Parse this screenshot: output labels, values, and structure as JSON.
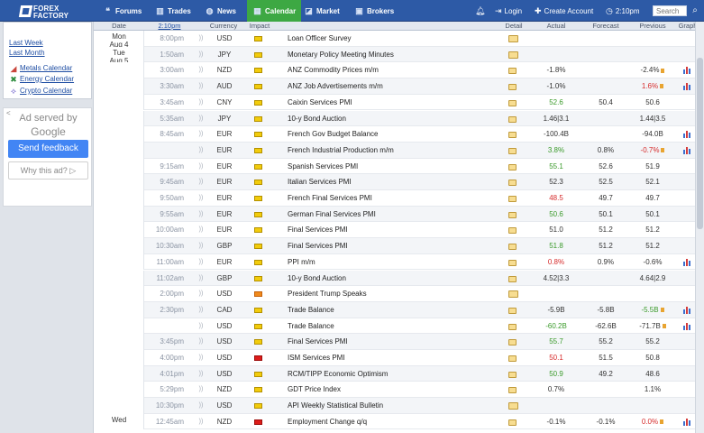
{
  "logo": {
    "line1": "FOREX",
    "line2": "FACTORY"
  },
  "nav": [
    {
      "label": "Forums",
      "icon": "forums-icon",
      "glyph": "❝",
      "active": false
    },
    {
      "label": "Trades",
      "icon": "trades-icon",
      "glyph": "▥",
      "active": false
    },
    {
      "label": "News",
      "icon": "news-icon",
      "glyph": "◍",
      "active": false
    },
    {
      "label": "Calendar",
      "icon": "calendar-icon",
      "glyph": "▦",
      "active": true
    },
    {
      "label": "Market",
      "icon": "market-icon",
      "glyph": "◪",
      "active": false
    },
    {
      "label": "Brokers",
      "icon": "brokers-icon",
      "glyph": "▣",
      "active": false
    }
  ],
  "header_right": {
    "login": "Login",
    "create_account": "Create Account",
    "clock": "2:10pm",
    "search_placeholder": "Search"
  },
  "sidebar": {
    "links": [
      "Last Week",
      "Last Month"
    ],
    "calendars": [
      {
        "label": "Metals Calendar",
        "icon": "metals-icon"
      },
      {
        "label": "Energy Calendar",
        "icon": "energy-icon"
      },
      {
        "label": "Crypto Calendar",
        "icon": "crypto-icon"
      }
    ]
  },
  "ad": {
    "close": "<",
    "served_by": "Ad served by",
    "google": "Google",
    "send_feedback": "Send feedback",
    "why": "Why this ad?"
  },
  "columns": {
    "date": "Date",
    "time": "2:10pm",
    "currency": "Currency",
    "impact": "Impact",
    "detail": "Detail",
    "actual": "Actual",
    "forecast": "Forecast",
    "previous": "Previous",
    "graph": "Graph"
  },
  "rows": [
    {
      "day": "Mon",
      "date": "Aug 4",
      "time": "8:00pm",
      "cur": "USD",
      "impact": "low",
      "event": "Loan Officer Survey",
      "actual": "",
      "forecast": "",
      "previous": "",
      "act_cls": "",
      "prev_cls": "",
      "rev": false,
      "graph": false
    },
    {
      "day": "Tue",
      "date": "Aug 5",
      "time": "1:50am",
      "cur": "JPY",
      "impact": "low",
      "event": "Monetary Policy Meeting Minutes",
      "actual": "",
      "forecast": "",
      "previous": "",
      "act_cls": "",
      "prev_cls": "",
      "rev": false,
      "graph": false
    },
    {
      "day": "",
      "date": "",
      "time": "3:00am",
      "cur": "NZD",
      "impact": "low",
      "event": "ANZ Commodity Prices m/m",
      "actual": "-1.8%",
      "forecast": "",
      "previous": "-2.4%",
      "act_cls": "",
      "prev_cls": "",
      "rev": true,
      "graph": true
    },
    {
      "day": "",
      "date": "",
      "time": "3:30am",
      "cur": "AUD",
      "impact": "low",
      "event": "ANZ Job Advertisements m/m",
      "actual": "-1.0%",
      "forecast": "",
      "previous": "1.6%",
      "act_cls": "",
      "prev_cls": "worse",
      "rev": true,
      "graph": true
    },
    {
      "day": "",
      "date": "",
      "time": "3:45am",
      "cur": "CNY",
      "impact": "low",
      "event": "Caixin Services PMI",
      "actual": "52.6",
      "forecast": "50.4",
      "previous": "50.6",
      "act_cls": "better",
      "prev_cls": "",
      "rev": false,
      "graph": false
    },
    {
      "day": "",
      "date": "",
      "time": "5:35am",
      "cur": "JPY",
      "impact": "low",
      "event": "10-y Bond Auction",
      "actual": "1.46|3.1",
      "forecast": "",
      "previous": "1.44|3.5",
      "act_cls": "",
      "prev_cls": "",
      "rev": false,
      "graph": false
    },
    {
      "day": "",
      "date": "",
      "time": "8:45am",
      "cur": "EUR",
      "impact": "low",
      "event": "French Gov Budget Balance",
      "actual": "-100.4B",
      "forecast": "",
      "previous": "-94.0B",
      "act_cls": "",
      "prev_cls": "",
      "rev": false,
      "graph": true
    },
    {
      "day": "",
      "date": "",
      "time": "",
      "cur": "EUR",
      "impact": "low",
      "event": "French Industrial Production m/m",
      "actual": "3.8%",
      "forecast": "0.8%",
      "previous": "-0.7%",
      "act_cls": "better",
      "prev_cls": "worse",
      "rev": true,
      "graph": true
    },
    {
      "day": "",
      "date": "",
      "time": "9:15am",
      "cur": "EUR",
      "impact": "low",
      "event": "Spanish Services PMI",
      "actual": "55.1",
      "forecast": "52.6",
      "previous": "51.9",
      "act_cls": "better",
      "prev_cls": "",
      "rev": false,
      "graph": false
    },
    {
      "day": "",
      "date": "",
      "time": "9:45am",
      "cur": "EUR",
      "impact": "low",
      "event": "Italian Services PMI",
      "actual": "52.3",
      "forecast": "52.5",
      "previous": "52.1",
      "act_cls": "",
      "prev_cls": "",
      "rev": false,
      "graph": false
    },
    {
      "day": "",
      "date": "",
      "time": "9:50am",
      "cur": "EUR",
      "impact": "low",
      "event": "French Final Services PMI",
      "actual": "48.5",
      "forecast": "49.7",
      "previous": "49.7",
      "act_cls": "worse",
      "prev_cls": "",
      "rev": false,
      "graph": false
    },
    {
      "day": "",
      "date": "",
      "time": "9:55am",
      "cur": "EUR",
      "impact": "low",
      "event": "German Final Services PMI",
      "actual": "50.6",
      "forecast": "50.1",
      "previous": "50.1",
      "act_cls": "better",
      "prev_cls": "",
      "rev": false,
      "graph": false
    },
    {
      "day": "",
      "date": "",
      "time": "10:00am",
      "cur": "EUR",
      "impact": "low",
      "event": "Final Services PMI",
      "actual": "51.0",
      "forecast": "51.2",
      "previous": "51.2",
      "act_cls": "",
      "prev_cls": "",
      "rev": false,
      "graph": false
    },
    {
      "day": "",
      "date": "",
      "time": "10:30am",
      "cur": "GBP",
      "impact": "low",
      "event": "Final Services PMI",
      "actual": "51.8",
      "forecast": "51.2",
      "previous": "51.2",
      "act_cls": "better",
      "prev_cls": "",
      "rev": false,
      "graph": false
    },
    {
      "day": "",
      "date": "",
      "time": "11:00am",
      "cur": "EUR",
      "impact": "low",
      "event": "PPI m/m",
      "actual": "0.8%",
      "forecast": "0.9%",
      "previous": "-0.6%",
      "act_cls": "worse",
      "prev_cls": "",
      "rev": false,
      "graph": true
    },
    {
      "day": "",
      "date": "",
      "time": "11:02am",
      "cur": "GBP",
      "impact": "low",
      "event": "10-y Bond Auction",
      "actual": "4.52|3.3",
      "forecast": "",
      "previous": "4.64|2.9",
      "act_cls": "",
      "prev_cls": "",
      "rev": false,
      "graph": false
    },
    {
      "day": "",
      "date": "",
      "time": "2:00pm",
      "cur": "USD",
      "impact": "med",
      "event": "President Trump Speaks",
      "actual": "",
      "forecast": "",
      "previous": "",
      "act_cls": "",
      "prev_cls": "",
      "rev": false,
      "graph": false
    },
    {
      "day": "",
      "date": "",
      "time": "2:30pm",
      "cur": "CAD",
      "impact": "low",
      "event": "Trade Balance",
      "actual": "-5.9B",
      "forecast": "-5.8B",
      "previous": "-5.5B",
      "act_cls": "",
      "prev_cls": "better",
      "rev": true,
      "graph": true
    },
    {
      "day": "",
      "date": "",
      "time": "",
      "cur": "USD",
      "impact": "low",
      "event": "Trade Balance",
      "actual": "-60.2B",
      "forecast": "-62.6B",
      "previous": "-71.7B",
      "act_cls": "better",
      "prev_cls": "",
      "rev": true,
      "graph": true
    },
    {
      "day": "",
      "date": "",
      "time": "3:45pm",
      "cur": "USD",
      "impact": "low",
      "event": "Final Services PMI",
      "actual": "55.7",
      "forecast": "55.2",
      "previous": "55.2",
      "act_cls": "better",
      "prev_cls": "",
      "rev": false,
      "graph": false
    },
    {
      "day": "",
      "date": "",
      "time": "4:00pm",
      "cur": "USD",
      "impact": "high",
      "event": "ISM Services PMI",
      "actual": "50.1",
      "forecast": "51.5",
      "previous": "50.8",
      "act_cls": "worse",
      "prev_cls": "",
      "rev": false,
      "graph": false
    },
    {
      "day": "",
      "date": "",
      "time": "4:01pm",
      "cur": "USD",
      "impact": "low",
      "event": "RCM/TIPP Economic Optimism",
      "actual": "50.9",
      "forecast": "49.2",
      "previous": "48.6",
      "act_cls": "better",
      "prev_cls": "",
      "rev": false,
      "graph": false
    },
    {
      "day": "",
      "date": "",
      "time": "5:29pm",
      "cur": "NZD",
      "impact": "low",
      "event": "GDT Price Index",
      "actual": "0.7%",
      "forecast": "",
      "previous": "1.1%",
      "act_cls": "",
      "prev_cls": "",
      "rev": false,
      "graph": false
    },
    {
      "day": "",
      "date": "",
      "time": "10:30pm",
      "cur": "USD",
      "impact": "low",
      "event": "API Weekly Statistical Bulletin",
      "actual": "",
      "forecast": "",
      "previous": "",
      "act_cls": "",
      "prev_cls": "",
      "rev": false,
      "graph": false
    },
    {
      "day": "Wed",
      "date": "",
      "time": "12:45am",
      "cur": "NZD",
      "impact": "high",
      "event": "Employment Change q/q",
      "actual": "-0.1%",
      "forecast": "-0.1%",
      "previous": "0.0%",
      "act_cls": "",
      "prev_cls": "worse",
      "rev": true,
      "graph": true
    }
  ]
}
